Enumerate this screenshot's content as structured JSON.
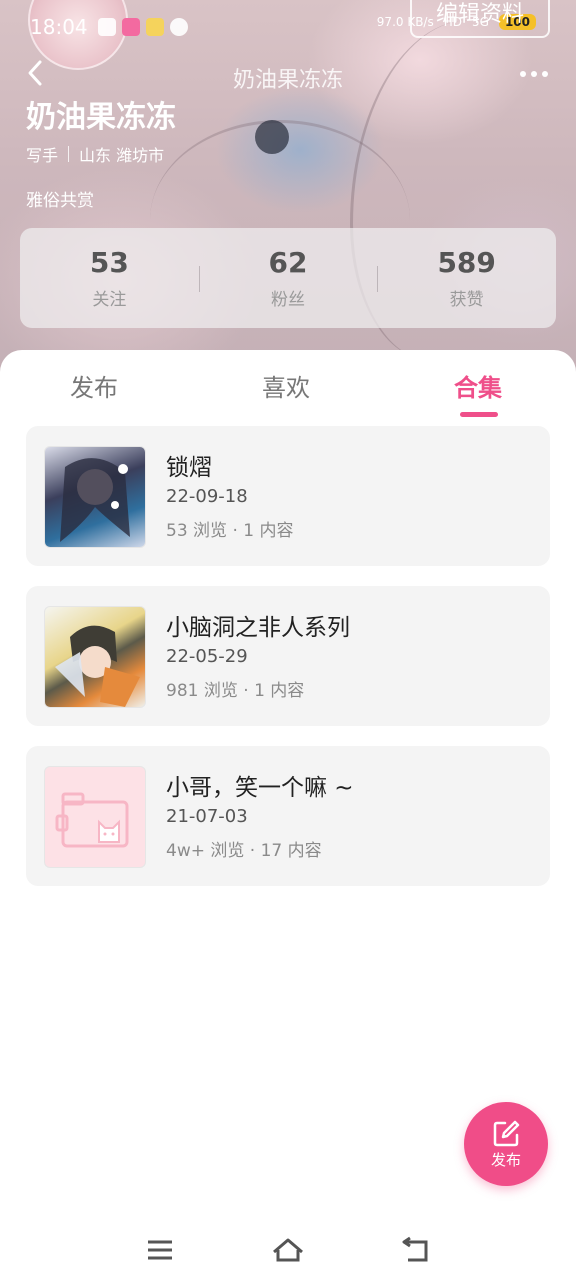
{
  "status_bar": {
    "time": "18:04",
    "net_speed": "97.0 KB/s",
    "hd": "HD",
    "signal": "5G",
    "battery": "100"
  },
  "header": {
    "edit_profile": "编辑资料",
    "nav_title": "奶油果冻冻",
    "user_name": "奶油果冻冻",
    "role": "写手",
    "location": "山东 潍坊市",
    "bio": "雅俗共赏"
  },
  "stats": [
    {
      "value": "53",
      "label": "关注"
    },
    {
      "value": "62",
      "label": "粉丝"
    },
    {
      "value": "589",
      "label": "获赞"
    }
  ],
  "tabs": [
    {
      "label": "发布"
    },
    {
      "label": "喜欢"
    },
    {
      "label": "合集"
    }
  ],
  "collections": [
    {
      "title": "锁熠",
      "date": "22-09-18",
      "stats": "53 浏览 · 1 内容"
    },
    {
      "title": "小脑洞之非人系列",
      "date": "22-05-29",
      "stats": "981 浏览 · 1 内容"
    },
    {
      "title": "小哥，笑一个嘛 ~",
      "date": "21-07-03",
      "stats": "4w+ 浏览 · 17 内容"
    }
  ],
  "fab": {
    "label": "发布"
  },
  "colors": {
    "accent": "#ef4f8a",
    "card_bg": "#f4f4f4"
  }
}
